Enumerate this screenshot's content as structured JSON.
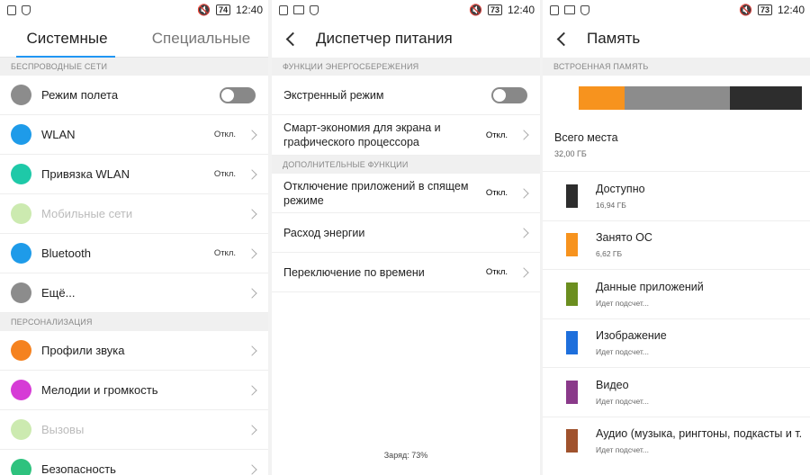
{
  "status_left": {
    "p1": [
      "notification-icon",
      "shield-icon"
    ],
    "p2": [
      "notification-icon",
      "image-icon",
      "shield-icon"
    ],
    "p3": [
      "notification-icon",
      "image-icon",
      "shield-icon"
    ]
  },
  "statusbar": [
    {
      "battery": "74",
      "time": "12:40"
    },
    {
      "battery": "73",
      "time": "12:40"
    },
    {
      "battery": "73",
      "time": "12:40"
    }
  ],
  "settings": {
    "tabs": [
      "Системные",
      "Специальные"
    ],
    "section_wireless": "БЕСПРОВОДНЫЕ СЕТИ",
    "section_personal": "ПЕРСОНАЛИЗАЦИЯ",
    "items": [
      {
        "label": "Режим полета",
        "icon": "airplane-icon",
        "color": "#8c8c8c",
        "control": "toggle"
      },
      {
        "label": "WLAN",
        "icon": "wifi-icon",
        "color": "#1e9be9",
        "status": "Откл."
      },
      {
        "label": "Привязка WLAN",
        "icon": "hotspot-icon",
        "color": "#1ec9a8",
        "status": "Откл."
      },
      {
        "label": "Мобильные сети",
        "icon": "mobile-data-icon",
        "color": "#8fd14f",
        "dim": true
      },
      {
        "label": "Bluetooth",
        "icon": "bluetooth-icon",
        "color": "#1e9be9",
        "status": "Откл."
      },
      {
        "label": "Ещё...",
        "icon": "more-icon",
        "color": "#8c8c8c"
      },
      {
        "label": "Профили звука",
        "icon": "bell-icon",
        "color": "#f5821f"
      },
      {
        "label": "Мелодии и громкость",
        "icon": "music-icon",
        "color": "#d63bd6"
      },
      {
        "label": "Вызовы",
        "icon": "phone-icon",
        "color": "#8fd14f",
        "dim": true
      },
      {
        "label": "Безопасность",
        "icon": "security-icon",
        "color": "#2ec27e"
      }
    ]
  },
  "power": {
    "title": "Диспетчер питания",
    "section_saving": "ФУНКЦИИ ЭНЕРГОСБЕРЕЖЕНИЯ",
    "section_extra": "ДОПОЛНИТЕЛЬНЫЕ ФУНКЦИИ",
    "emergency": "Экстренный режим",
    "smart_line1": "Смарт-экономия для экрана и",
    "smart_line2": "графического процессора",
    "smart_status": "Откл.",
    "sleep_line1": "Отключение приложений в спящем",
    "sleep_line2": "режиме",
    "sleep_status": "Откл.",
    "usage": "Расход энергии",
    "schedule": "Переключение по времени",
    "schedule_status": "Откл.",
    "charge": "Заряд: 73%"
  },
  "memory": {
    "title": "Память",
    "section": "ВСТРОЕННАЯ ПАМЯТЬ",
    "bar_segments": [
      {
        "color": "#f7931e",
        "fraction": 0.207
      },
      {
        "color": "#8c8c8c",
        "fraction": 0.469
      },
      {
        "color": "#2d2d2d",
        "fraction": 0.324
      }
    ],
    "total_label": "Всего места",
    "total_value": "32,00 ГБ",
    "items": [
      {
        "label": "Доступно",
        "value": "16,94 ГБ",
        "color": "#2d2d2d"
      },
      {
        "label": "Занято ОС",
        "value": "6,62 ГБ",
        "color": "#f7931e"
      },
      {
        "label": "Данные приложений",
        "value": "Идет подсчет...",
        "color": "#6b8e1f"
      },
      {
        "label": "Изображение",
        "value": "Идет подсчет...",
        "color": "#1e6fdc"
      },
      {
        "label": "Видео",
        "value": "Идет подсчет...",
        "color": "#8a3a8a"
      },
      {
        "label": "Аудио (музыка, рингтоны, подкасты и т.",
        "value": "Идет подсчет...",
        "color": "#a0522d"
      }
    ]
  }
}
